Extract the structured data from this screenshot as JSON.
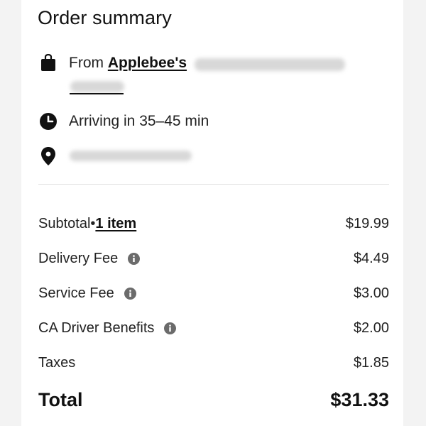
{
  "header": {
    "title": "Order summary"
  },
  "store": {
    "prefix": "From ",
    "name": "Applebee's"
  },
  "arrival": {
    "text": "Arriving in 35–45 min"
  },
  "fees": {
    "subtotal_label": "Subtotal",
    "subtotal_separator": " • ",
    "items_link": "1 item",
    "subtotal_value": "$19.99",
    "delivery_label": "Delivery Fee",
    "delivery_value": "$4.49",
    "service_label": "Service Fee",
    "service_value": "$3.00",
    "driver_label": "CA Driver Benefits",
    "driver_value": "$2.00",
    "taxes_label": "Taxes",
    "taxes_value": "$1.85"
  },
  "total": {
    "label": "Total",
    "value": "$31.33"
  },
  "icons": {
    "store": "shopping-bag-icon",
    "time": "clock-icon",
    "location": "location-pin-icon",
    "info": "info-icon"
  },
  "colors": {
    "text": "#111111",
    "info_icon": "#6b6b6b",
    "divider": "#e2e2e2"
  }
}
